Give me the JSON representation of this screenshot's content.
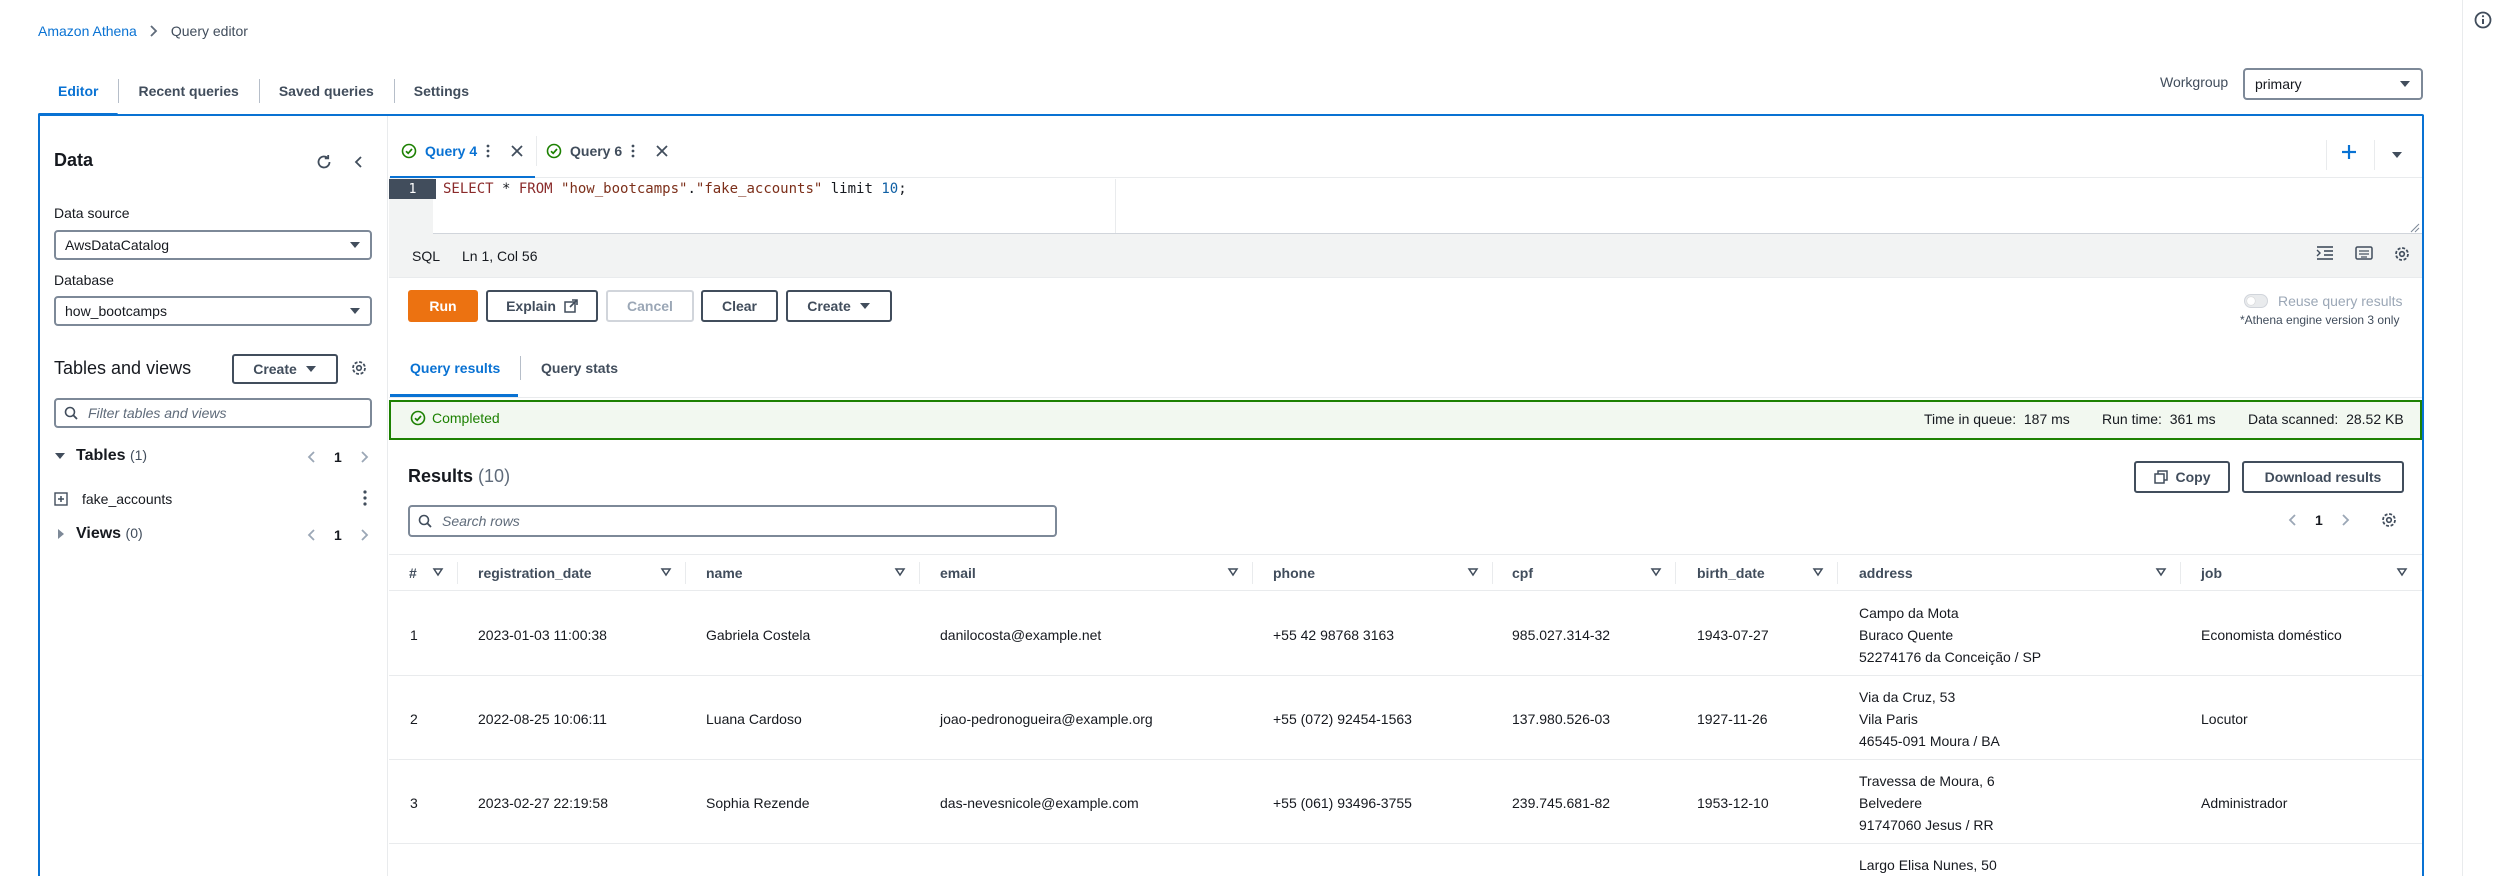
{
  "breadcrumb": {
    "service": "Amazon Athena",
    "current": "Query editor"
  },
  "main_tabs": [
    "Editor",
    "Recent queries",
    "Saved queries",
    "Settings"
  ],
  "workgroup": {
    "label": "Workgroup",
    "value": "primary"
  },
  "data_panel": {
    "title": "Data",
    "data_source_label": "Data source",
    "data_source_value": "AwsDataCatalog",
    "database_label": "Database",
    "database_value": "how_bootcamps",
    "tables_and_views_title": "Tables and views",
    "create_label": "Create",
    "filter_placeholder": "Filter tables and views",
    "tables_label": "Tables",
    "tables_count": "(1)",
    "tables_page": "1",
    "table_items": [
      "fake_accounts"
    ],
    "views_label": "Views",
    "views_count": "(0)",
    "views_page": "1"
  },
  "query_tabs": [
    {
      "label": "Query 4",
      "active": true
    },
    {
      "label": "Query 6",
      "active": false
    }
  ],
  "editor": {
    "line_number": "1",
    "code_parts": {
      "select": "SELECT",
      "star": " * ",
      "from": "FROM",
      "db": " \"how_bootcamps\"",
      "dot": ".",
      "table": "\"fake_accounts\"",
      "limit": " limit ",
      "n": "10",
      "end": ";"
    },
    "language": "SQL",
    "cursor": "Ln 1, Col 56"
  },
  "actions": {
    "run": "Run",
    "explain": "Explain",
    "cancel": "Cancel",
    "clear": "Clear",
    "create": "Create",
    "reuse_label": "Reuse query results",
    "reuse_note": "*Athena engine version 3 only"
  },
  "result_tabs": [
    "Query results",
    "Query stats"
  ],
  "status": {
    "state": "Completed",
    "time_in_queue_label": "Time in queue:",
    "time_in_queue": "187 ms",
    "run_time_label": "Run time:",
    "run_time": "361 ms",
    "data_scanned_label": "Data scanned:",
    "data_scanned": "28.52 KB"
  },
  "results": {
    "title": "Results",
    "count": "(10)",
    "copy_label": "Copy",
    "download_label": "Download results",
    "search_placeholder": "Search rows",
    "page": "1",
    "columns": [
      "#",
      "registration_date",
      "name",
      "email",
      "phone",
      "cpf",
      "birth_date",
      "address",
      "job"
    ],
    "rows": [
      {
        "n": "1",
        "registration_date": "2023-01-03 11:00:38",
        "name": "Gabriela Costela",
        "email": "danilocosta@example.net",
        "phone": "+55 42 98768 3163",
        "cpf": "985.027.314-32",
        "birth_date": "1943-07-27",
        "address": [
          "Campo da Mota",
          "Buraco Quente",
          "52274176 da Conceição / SP"
        ],
        "job": "Economista doméstico"
      },
      {
        "n": "2",
        "registration_date": "2022-08-25 10:06:11",
        "name": "Luana Cardoso",
        "email": "joao-pedronogueira@example.org",
        "phone": "+55 (072) 92454-1563",
        "cpf": "137.980.526-03",
        "birth_date": "1927-11-26",
        "address": [
          "Via da Cruz, 53",
          "Vila Paris",
          "46545-091 Moura / BA"
        ],
        "job": "Locutor"
      },
      {
        "n": "3",
        "registration_date": "2023-02-27 22:19:58",
        "name": "Sophia Rezende",
        "email": "das-nevesnicole@example.com",
        "phone": "+55 (061) 93496-3755",
        "cpf": "239.745.681-82",
        "birth_date": "1953-12-10",
        "address": [
          "Travessa de Moura, 6",
          "Belvedere",
          "91747060 Jesus / RR"
        ],
        "job": "Administrador"
      },
      {
        "address": [
          "Largo Elisa Nunes, 50"
        ]
      }
    ]
  },
  "colors": {
    "accent": "#0972d3",
    "run": "#ec7211",
    "success": "#1d8102"
  }
}
